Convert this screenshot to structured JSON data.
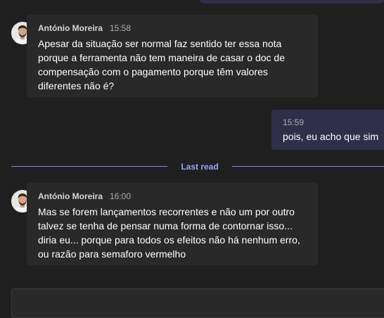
{
  "colors": {
    "background": "#1f1f1f",
    "incoming_bubble": "#292929",
    "outgoing_bubble": "#2f2f4a",
    "accent": "#7f85f5",
    "presence_available": "#92c353"
  },
  "messages": [
    {
      "sender": "António Moreira",
      "time": "15:58",
      "avatar_icon": "person-avatar-icon",
      "presence_icon": "available-check-icon",
      "lines": [
        "Apesar da situação ser normal faz sentido ter essa nota",
        "porque a ferramenta não tem maneira de casar o doc de",
        "compensação com o pagamento porque têm valores",
        "diferentes não é?"
      ]
    },
    {
      "sender": "António Moreira",
      "time": "16:00",
      "avatar_icon": "person-avatar-icon",
      "presence_icon": "available-check-icon",
      "lines": [
        "Mas se forem lançamentos recorrentes e não um por outro",
        "talvez se tenha de pensar numa forma de contornar isso...",
        "diria eu... porque para todos os efeitos não há nenhum erro,",
        "ou razão para semaforo vermelho"
      ]
    }
  ],
  "own_message": {
    "time": "15:59",
    "text": "pois, eu acho que sim"
  },
  "divider": {
    "label": "Last read"
  }
}
